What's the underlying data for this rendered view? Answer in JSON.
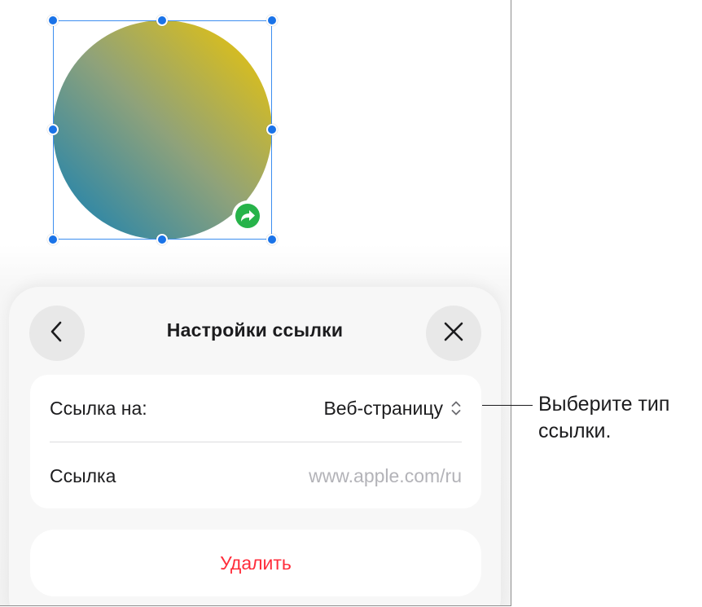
{
  "sheet": {
    "title": "Настройки ссылки",
    "back_icon": "chevron-left-icon",
    "close_icon": "close-icon"
  },
  "link_settings": {
    "link_to_label": "Ссылка на:",
    "link_to_value": "Веб-страницу",
    "link_label": "Ссылка",
    "link_placeholder": "www.apple.com/ru"
  },
  "delete_button": {
    "label": "Удалить"
  },
  "callout": {
    "text": "Выберите тип\nссылки."
  },
  "shape": {
    "gradient_colors": [
      "#f0c600",
      "#117fb4"
    ],
    "link_badge_color": "#27b34a",
    "link_badge_icon": "link-arrow-icon"
  },
  "colors": {
    "accent": "#1a73e8",
    "destructive": "#ff2d3b",
    "placeholder": "#b3b3b8"
  }
}
